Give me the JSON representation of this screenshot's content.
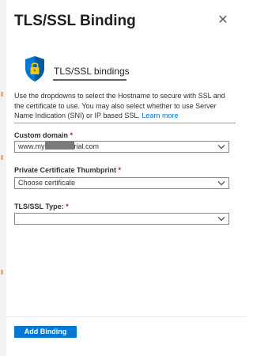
{
  "panel": {
    "title": "TLS/SSL Binding",
    "close_symbol": "✕"
  },
  "tab": {
    "icon": "shield-lock-icon",
    "label": "TLS/SSL bindings"
  },
  "description": {
    "text": "Use the dropdowns to select the Hostname to secure with SSL and the certificate to use. You may also select whether to use Server Name Indication (SNI) or IP based SSL. ",
    "link": "Learn more"
  },
  "fields": {
    "custom_domain": {
      "label": "Custom domain",
      "required_mark": "*",
      "value_prefix": "www.my",
      "value_suffix": "rial.com"
    },
    "certificate": {
      "label": "Private Certificate Thumbprint",
      "required_mark": "*",
      "value": "Choose certificate"
    },
    "tls_type": {
      "label": "TLS/SSL Type:",
      "required_mark": "*",
      "value": ""
    }
  },
  "footer": {
    "add_button": "Add Binding"
  },
  "colors": {
    "accent": "#0078d4",
    "shield_blue": "#0078d4",
    "lock_gold": "#f2c811"
  }
}
